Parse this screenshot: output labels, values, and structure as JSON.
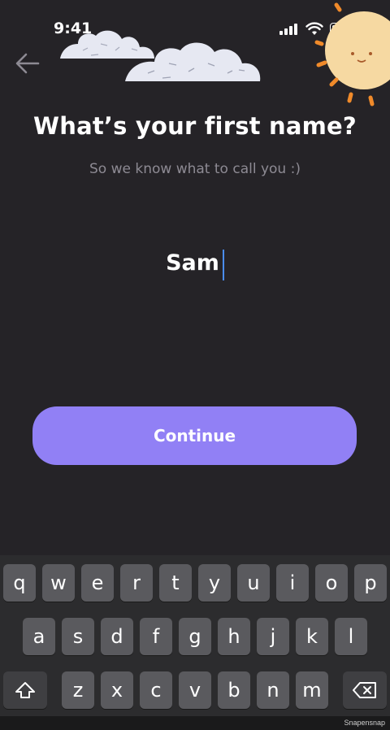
{
  "status_bar": {
    "time": "9:41",
    "icons": [
      "signal-icon",
      "wifi-icon",
      "battery-icon"
    ]
  },
  "header": {
    "back_icon": "arrow-left-icon",
    "title": "What’s your first name?",
    "subtitle": "So we know what to call you :)"
  },
  "name_field": {
    "value": "Sam"
  },
  "actions": {
    "continue_label": "Continue"
  },
  "keyboard": {
    "row1": [
      "q",
      "w",
      "e",
      "r",
      "t",
      "y",
      "u",
      "i",
      "o",
      "p"
    ],
    "row2": [
      "a",
      "s",
      "d",
      "f",
      "g",
      "h",
      "j",
      "k",
      "l"
    ],
    "row3": [
      "z",
      "x",
      "c",
      "v",
      "b",
      "n",
      "m"
    ],
    "shift_icon": "shift-icon",
    "delete_icon": "backspace-icon"
  },
  "watermark": "Snapensnap",
  "colors": {
    "background": "#252327",
    "accent": "#9180f5",
    "caret": "#4a8cf2",
    "subtitle": "#8d8a93",
    "key": "#5a5a5e"
  }
}
